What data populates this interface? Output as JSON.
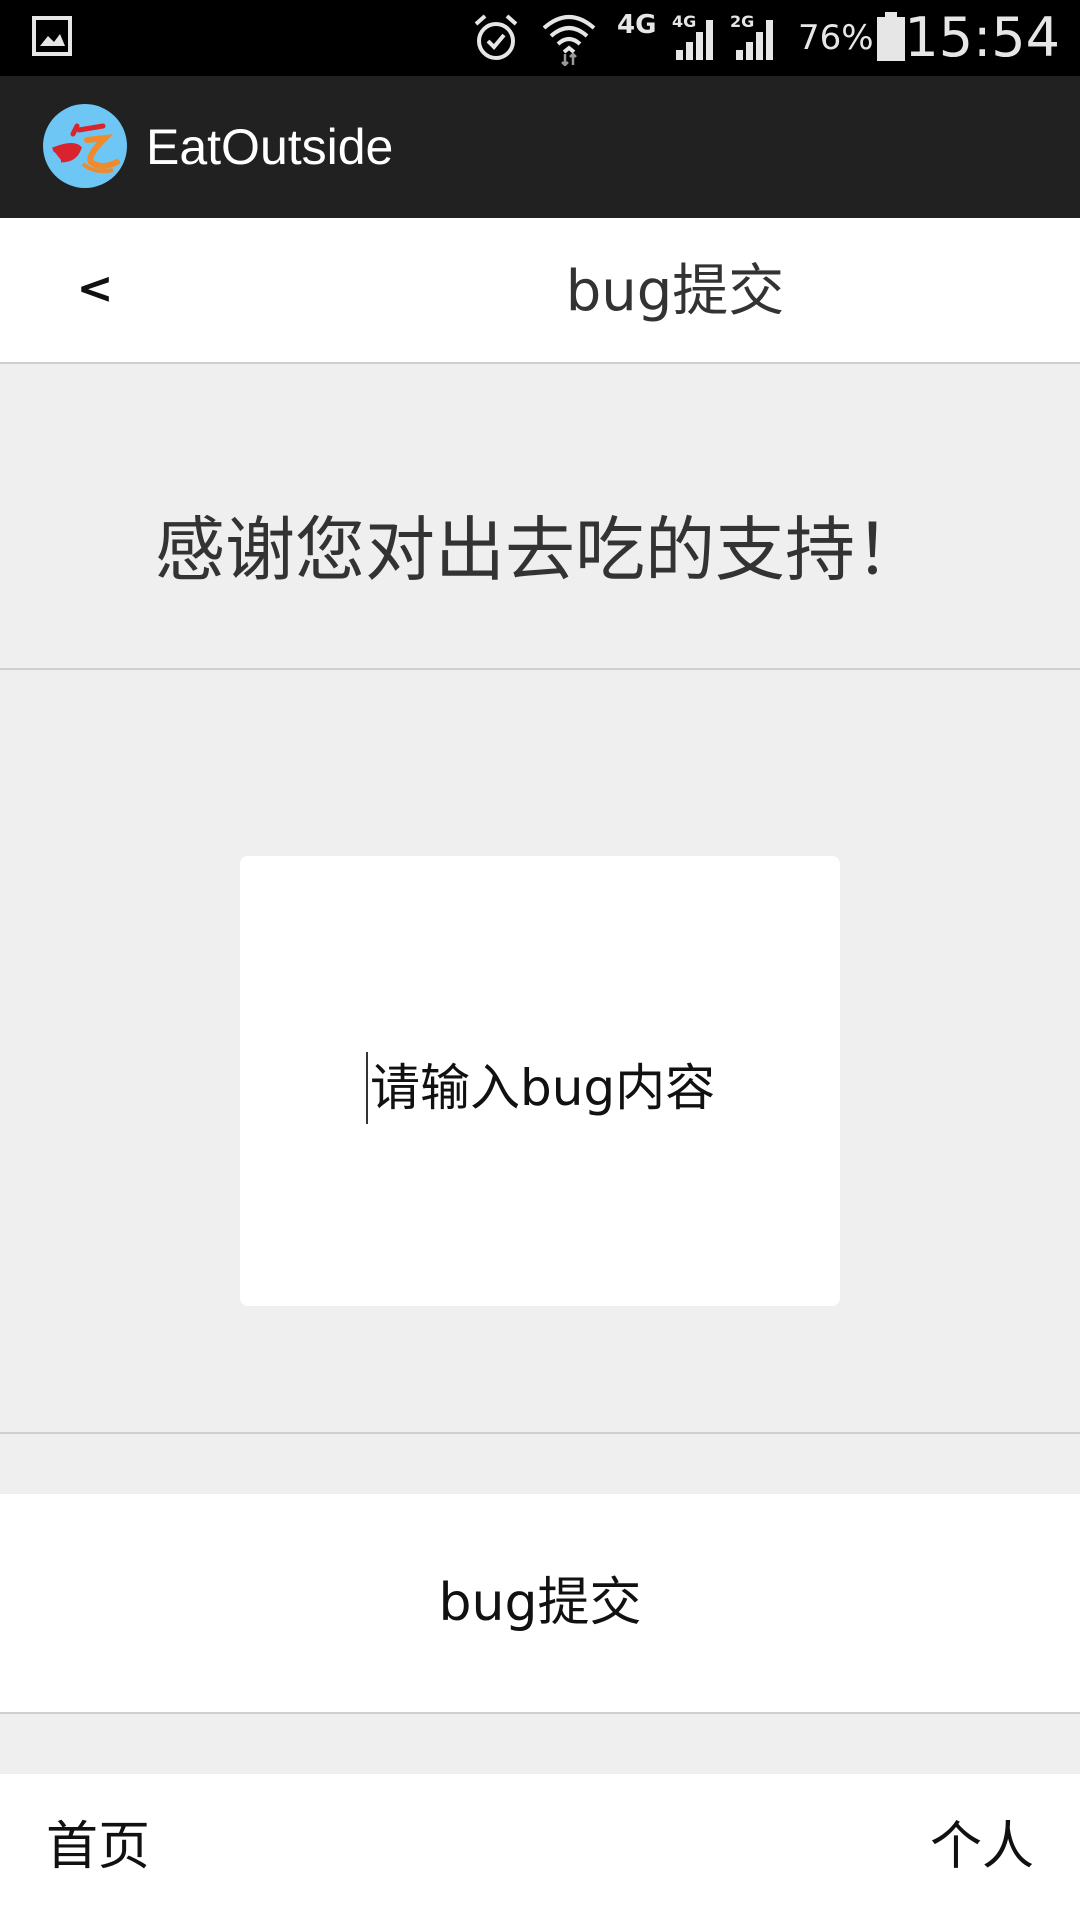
{
  "status_bar": {
    "network": "4G",
    "signal_1_label": "4G",
    "signal_2_label": "2G",
    "battery": "76%",
    "time": "15:54",
    "icons": [
      "gallery-icon",
      "alarm-icon",
      "wifi-icon",
      "signal-icon",
      "battery-icon"
    ]
  },
  "app_bar": {
    "title": "EatOutside",
    "logo": "app-logo-icon",
    "logo_color": "#6ec6f5"
  },
  "header": {
    "back_label": "<",
    "title": "bug提交"
  },
  "thanks": {
    "text": "感谢您对出去吃的支持！"
  },
  "bug_input": {
    "placeholder": "请输入bug内容",
    "value": ""
  },
  "submit": {
    "label": "bug提交"
  },
  "bottom_nav": {
    "home": "首页",
    "profile": "个人"
  },
  "colors": {
    "status_bar": "#000000",
    "app_bar": "#212121",
    "page_bg": "#efefef",
    "card_bg": "#ffffff",
    "divider": "#cfcfcf"
  }
}
